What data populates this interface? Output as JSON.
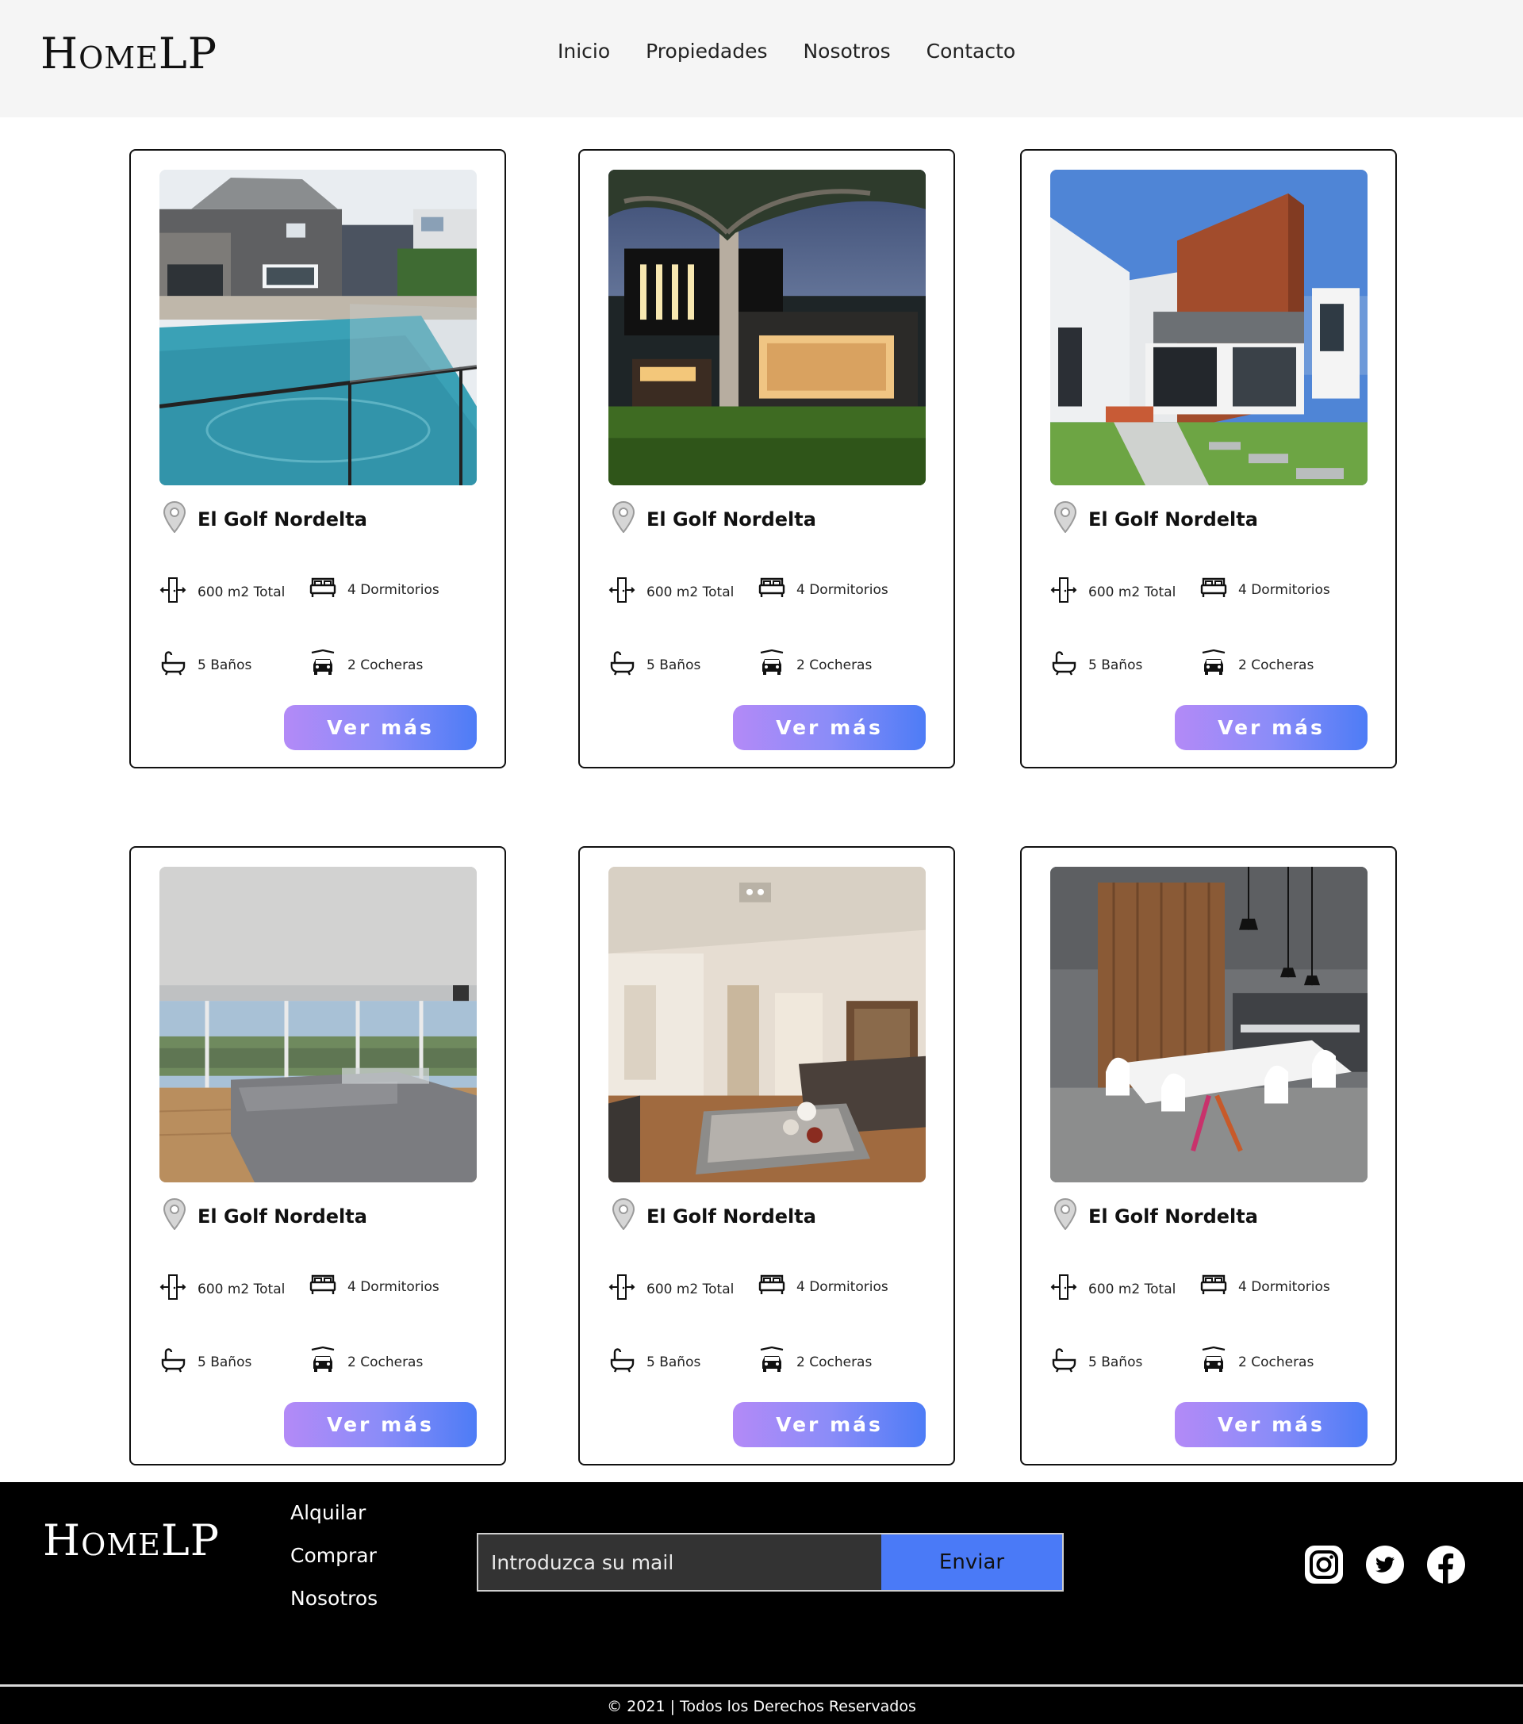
{
  "header": {
    "logo": "HomeLP",
    "nav": [
      "Inicio",
      "Propiedades",
      "Nosotros",
      "Contacto"
    ]
  },
  "cards": [
    {
      "location": "El Golf Nordelta",
      "area": "600 m2 Total",
      "bedrooms": "4 Dormitorios",
      "bathrooms": "5 Baños",
      "garages": "2 Cocheras",
      "button": "Ver más",
      "photo": "house-with-pool"
    },
    {
      "location": "El Golf Nordelta",
      "area": "600 m2 Total",
      "bedrooms": "4 Dormitorios",
      "bathrooms": "5 Baños",
      "garages": "2 Cocheras",
      "button": "Ver más",
      "photo": "modern-house-with-tree-at-dusk"
    },
    {
      "location": "El Golf Nordelta",
      "area": "600 m2 Total",
      "bedrooms": "4 Dormitorios",
      "bathrooms": "5 Baños",
      "garages": "2 Cocheras",
      "button": "Ver más",
      "photo": "modern-brick-house-facade"
    },
    {
      "location": "El Golf Nordelta",
      "area": "600 m2 Total",
      "bedrooms": "4 Dormitorios",
      "bathrooms": "5 Baños",
      "garages": "2 Cocheras",
      "button": "Ver más",
      "photo": "living-room-with-view"
    },
    {
      "location": "El Golf Nordelta",
      "area": "600 m2 Total",
      "bedrooms": "4 Dormitorios",
      "bathrooms": "5 Baños",
      "garages": "2 Cocheras",
      "button": "Ver más",
      "photo": "lounge-interior"
    },
    {
      "location": "El Golf Nordelta",
      "area": "600 m2 Total",
      "bedrooms": "4 Dormitorios",
      "bathrooms": "5 Baños",
      "garages": "2 Cocheras",
      "button": "Ver más",
      "photo": "dining-kitchen-interior"
    }
  ],
  "footer": {
    "logo": "HomeLP",
    "links": [
      "Alquilar",
      "Comprar",
      "Nosotros"
    ],
    "email_placeholder": "Introduzca su mail",
    "submit": "Enviar",
    "socials": [
      "instagram-icon",
      "twitter-icon",
      "facebook-icon"
    ],
    "copyright": "© 2021 | Todos los Derechos Reservados"
  },
  "colors": {
    "header_bg": "#f5f5f5",
    "button_gradient_start": "#b38af7",
    "button_gradient_end": "#4d7cf6",
    "footer_bg": "#000000",
    "submit_bg": "#4a7af7"
  }
}
